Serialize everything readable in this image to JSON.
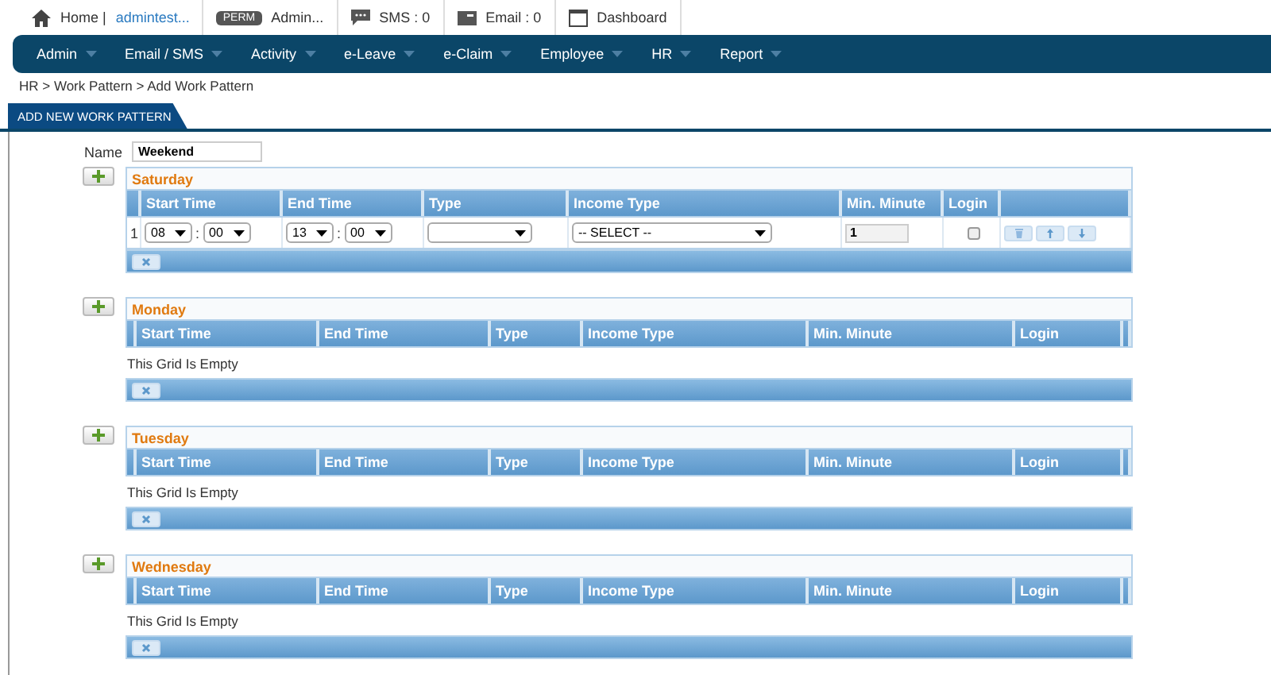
{
  "top_bar": {
    "home": "Home |",
    "user": "admintest...",
    "perm_badge": "PERM",
    "perm_label": "Admin...",
    "sms": "SMS : 0",
    "email": "Email : 0",
    "dashboard": "Dashboard"
  },
  "menu": [
    "Admin",
    "Email / SMS",
    "Activity",
    "e-Leave",
    "e-Claim",
    "Employee",
    "HR",
    "Report"
  ],
  "breadcrumb": "HR > Work Pattern > Add Work Pattern",
  "tab": "ADD NEW WORK PATTERN",
  "name_label": "Name",
  "name_value": "Weekend",
  "days": [
    {
      "title": "Saturday",
      "columns": [
        "Start Time",
        "End Time",
        "Type",
        "Income Type",
        "Min. Minute",
        "Login"
      ],
      "rows": [
        {
          "number": "1",
          "start_hour": "08",
          "start_separator": ":",
          "end_separator": ":",
          "start_minute": "00",
          "end_hour": "13",
          "end_minute": "00",
          "type": "",
          "income_type": "-- SELECT --",
          "min_minute": "1",
          "login": false
        }
      ]
    },
    {
      "title": "Monday",
      "columns": [
        "Start Time",
        "End Time",
        "Type",
        "Income Type",
        "Min. Minute",
        "Login"
      ],
      "empty_text": "This Grid Is Empty"
    },
    {
      "title": "Tuesday",
      "columns": [
        "Start Time",
        "End Time",
        "Type",
        "Income Type",
        "Min. Minute",
        "Login"
      ],
      "empty_text": "This Grid Is Empty"
    },
    {
      "title": "Wednesday",
      "columns": [
        "Start Time",
        "End Time",
        "Type",
        "Income Type",
        "Min. Minute",
        "Login"
      ],
      "empty_text": "This Grid Is Empty"
    }
  ]
}
